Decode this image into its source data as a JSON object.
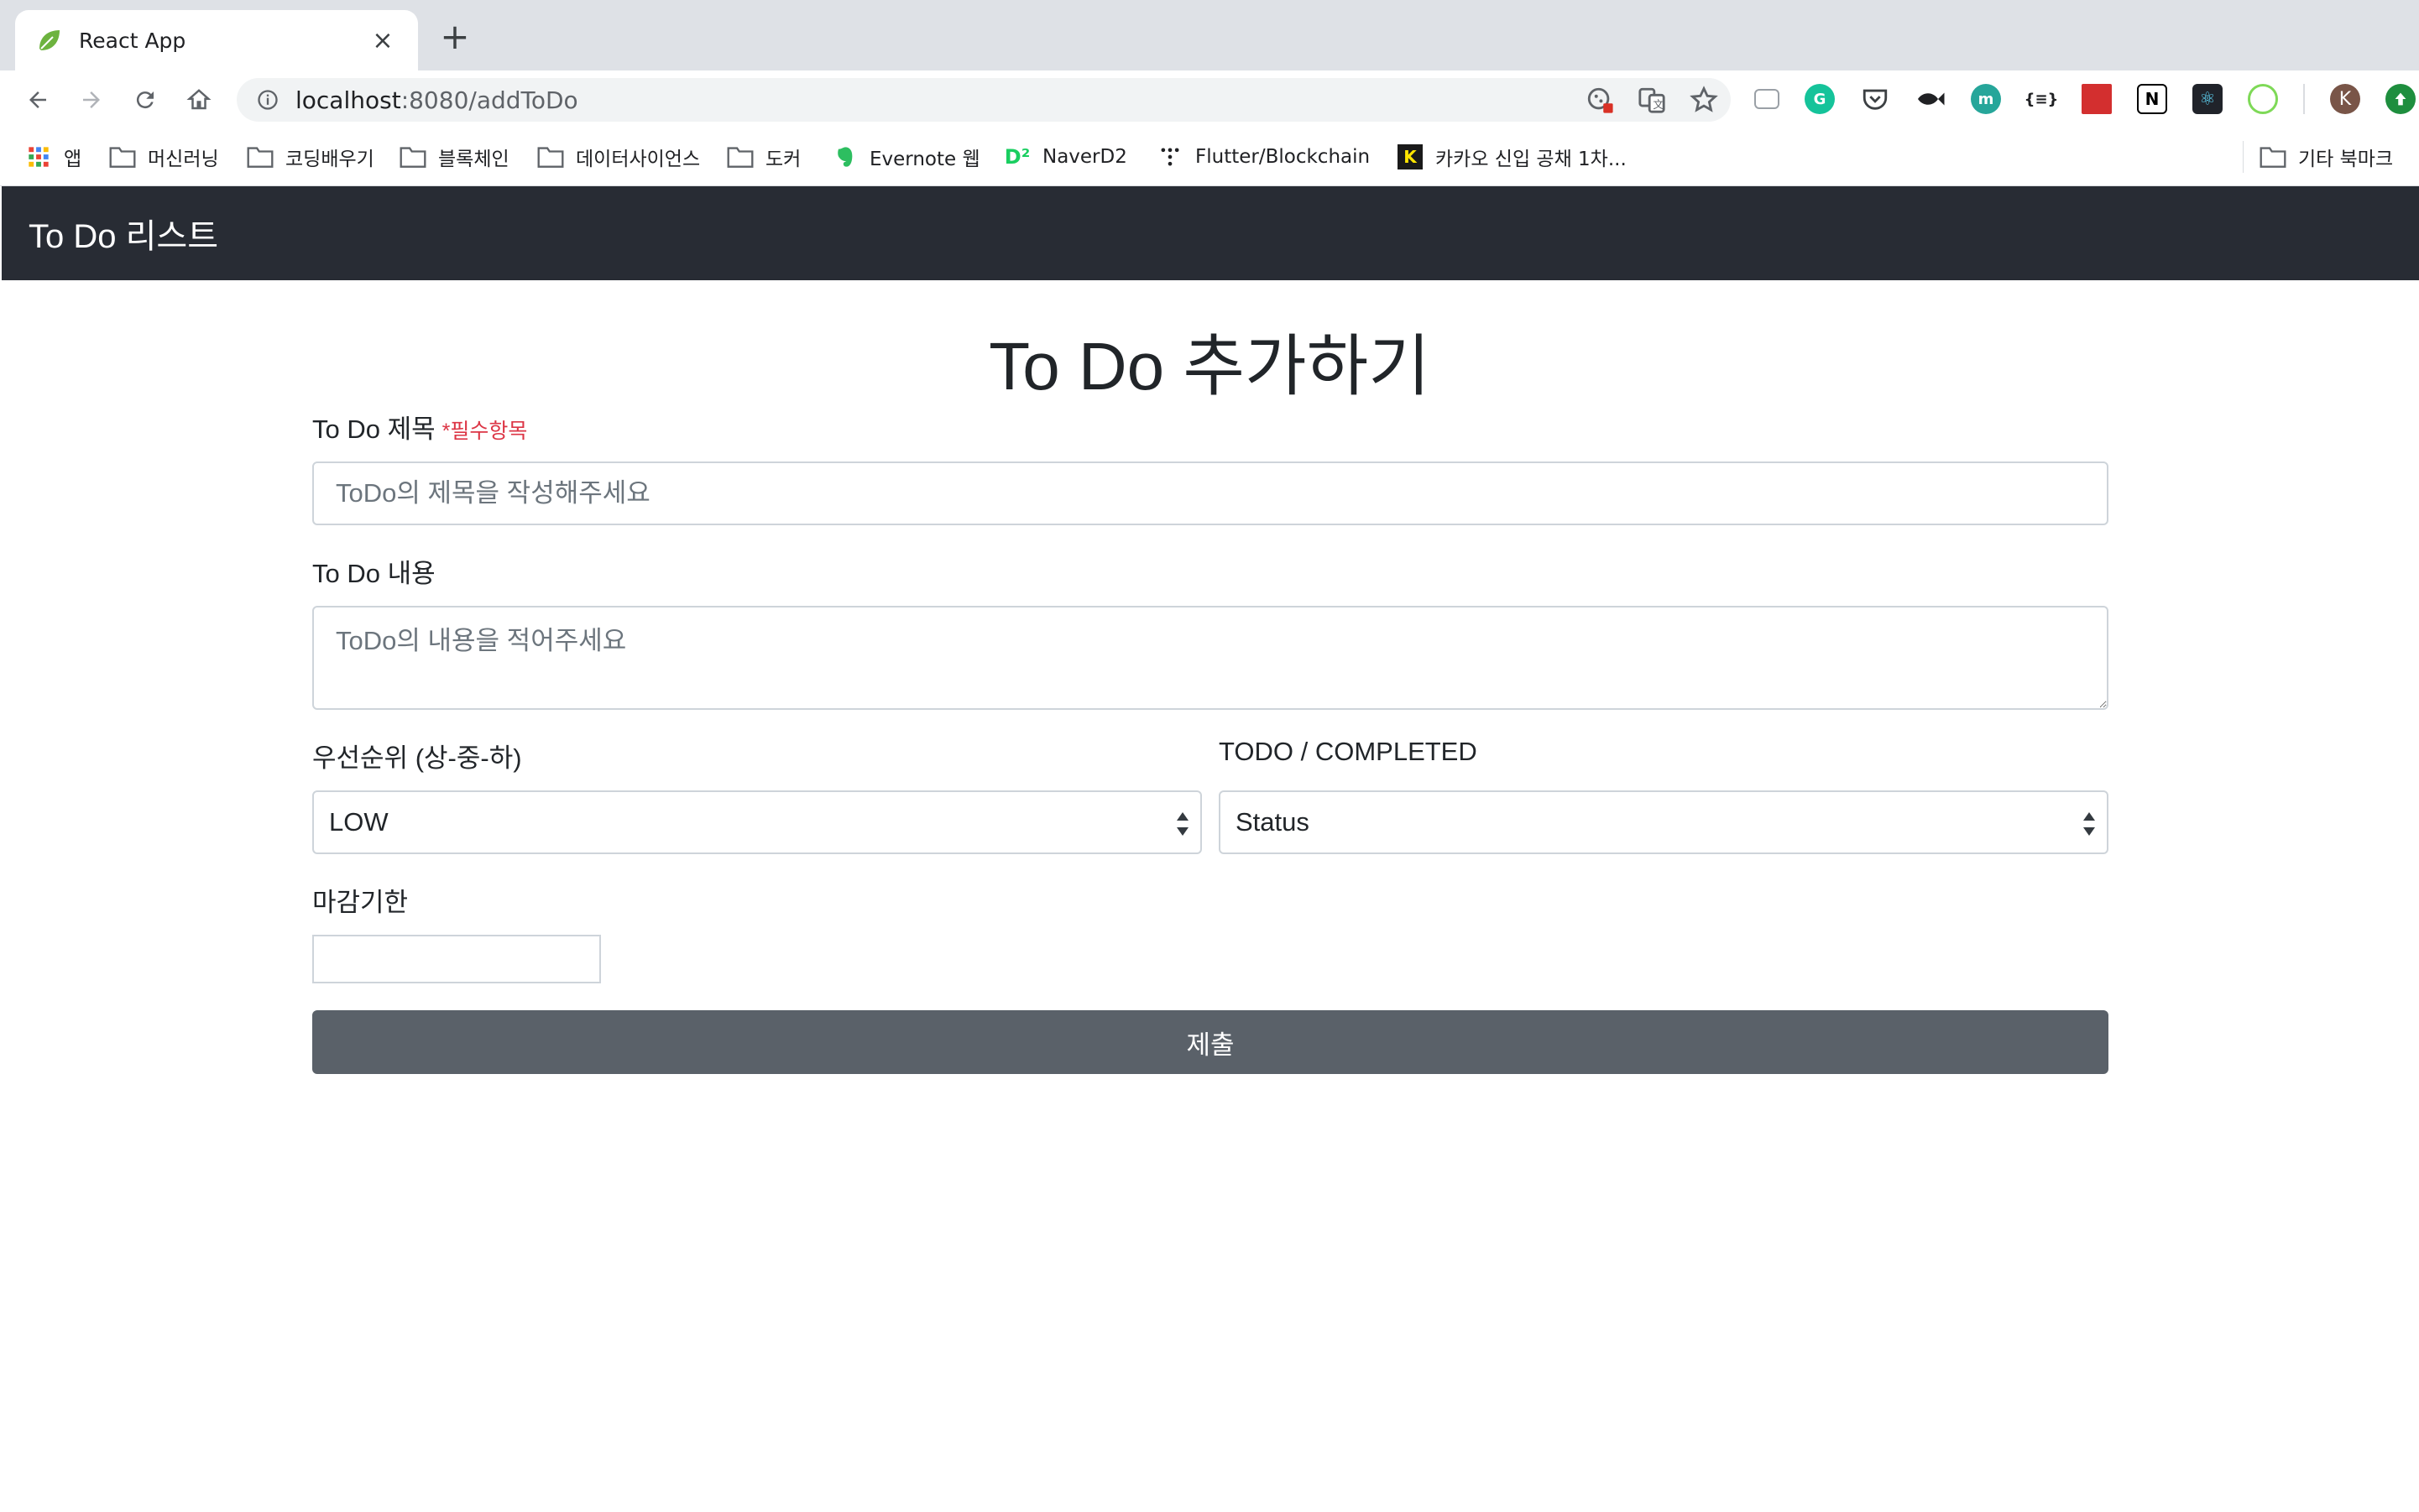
{
  "browser": {
    "tab": {
      "title": "React App",
      "favicon": "leaf-icon",
      "close": "×"
    },
    "new_tab": "+",
    "omnibox": {
      "host": "localhost",
      "rest": ":8080/addToDo"
    },
    "profile_initial": "K",
    "bookmarks": [
      {
        "label": "앱",
        "icon": "apps-grid-icon"
      },
      {
        "label": "머신러닝",
        "icon": "folder-icon"
      },
      {
        "label": "코딩배우기",
        "icon": "folder-icon"
      },
      {
        "label": "블록체인",
        "icon": "folder-icon"
      },
      {
        "label": "데이터사이언스",
        "icon": "folder-icon"
      },
      {
        "label": "도커",
        "icon": "folder-icon"
      },
      {
        "label": "Evernote 웹",
        "icon": "evernote-icon"
      },
      {
        "label": "NaverD2",
        "icon": "naverd2-icon"
      },
      {
        "label": "Flutter/Blockchain",
        "icon": "dots-icon"
      },
      {
        "label": "카카오 신입 공채 1차...",
        "icon": "kakao-icon"
      }
    ],
    "other_bookmarks": "기타 북마크"
  },
  "app": {
    "brand": "To Do 리스트",
    "page_title": "To Do 추가하기",
    "form": {
      "title_label": "To Do 제목",
      "title_required": "*필수항목",
      "title_placeholder": "ToDo의 제목을 작성해주세요",
      "content_label": "To Do 내용",
      "content_placeholder": "ToDo의 내용을 적어주세요",
      "priority_label": "우선순위 (상-중-하)",
      "priority_value": "LOW",
      "status_label": "TODO / COMPLETED",
      "status_value": "Status",
      "deadline_label": "마감기한",
      "submit_label": "제출"
    }
  },
  "colors": {
    "navbar": "#282c34",
    "submit": "#5a6169",
    "required": "#dc3545"
  }
}
